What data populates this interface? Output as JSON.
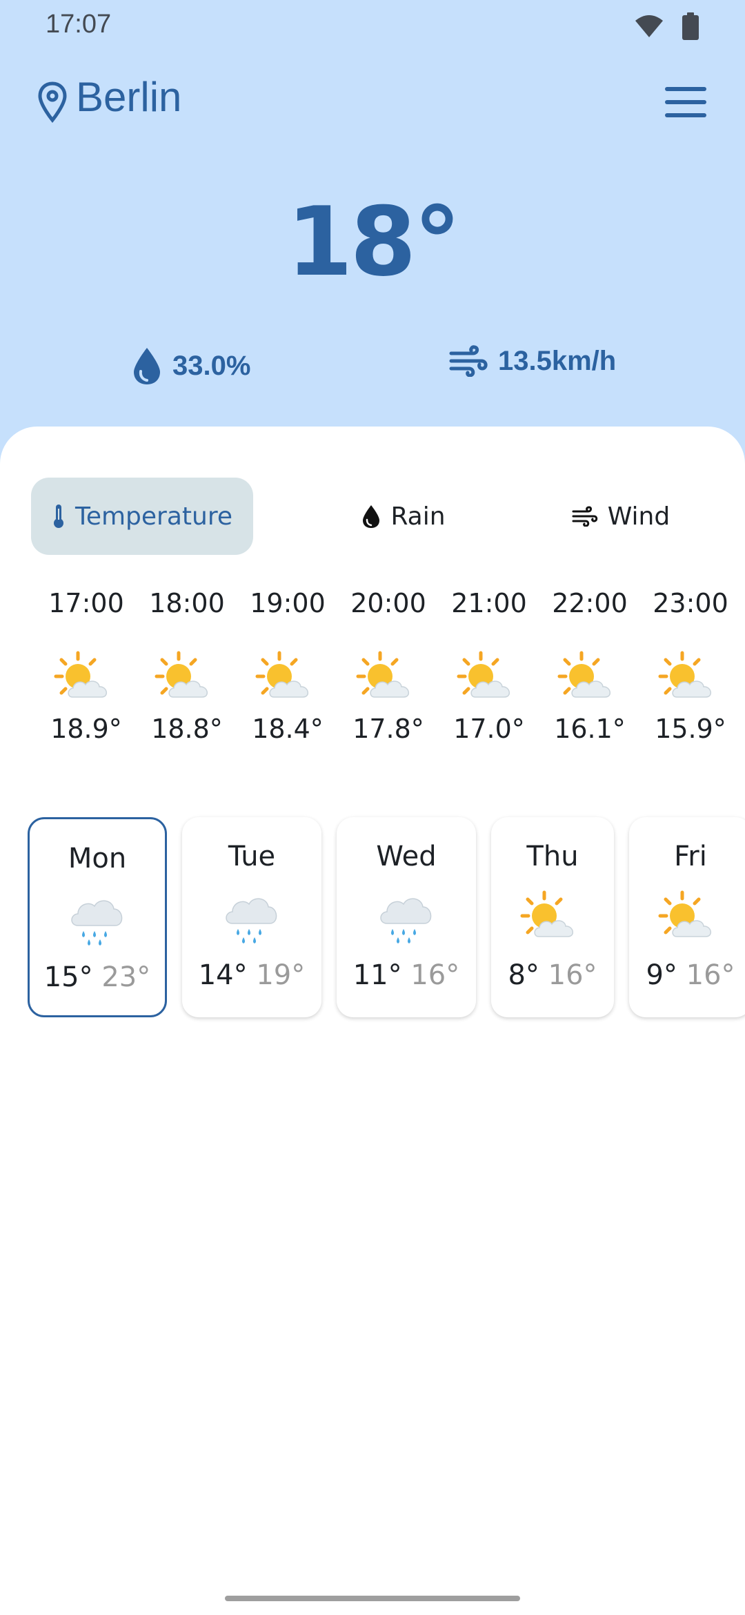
{
  "status_bar": {
    "time": "17:07",
    "icons": [
      "wifi-icon",
      "battery-icon"
    ]
  },
  "header": {
    "city": "Berlin",
    "location_icon": "location-pin-icon",
    "menu_icon": "menu-icon"
  },
  "current": {
    "temperature": "18°",
    "humidity": "33.0%",
    "wind": "13.5km/h"
  },
  "tabs": [
    {
      "label": "Temperature",
      "icon": "thermometer-icon",
      "active": true
    },
    {
      "label": "Rain",
      "icon": "raindrop-icon",
      "active": false
    },
    {
      "label": "Wind",
      "icon": "wind-icon",
      "active": false
    }
  ],
  "hourly": [
    {
      "time": "17:00",
      "icon": "sun-behind-cloud-icon",
      "temp": "18.9°"
    },
    {
      "time": "18:00",
      "icon": "sun-behind-cloud-icon",
      "temp": "18.8°"
    },
    {
      "time": "19:00",
      "icon": "sun-behind-cloud-icon",
      "temp": "18.4°"
    },
    {
      "time": "20:00",
      "icon": "sun-behind-cloud-icon",
      "temp": "17.8°"
    },
    {
      "time": "21:00",
      "icon": "sun-behind-cloud-icon",
      "temp": "17.0°"
    },
    {
      "time": "22:00",
      "icon": "sun-behind-cloud-icon",
      "temp": "16.1°"
    },
    {
      "time": "23:00",
      "icon": "sun-behind-cloud-icon",
      "temp": "15.9°"
    }
  ],
  "daily": [
    {
      "day": "Mon",
      "icon": "rain-cloud-icon",
      "low": "15°",
      "high": "23°",
      "selected": true
    },
    {
      "day": "Tue",
      "icon": "rain-cloud-icon",
      "low": "14°",
      "high": "19°",
      "selected": false
    },
    {
      "day": "Wed",
      "icon": "rain-cloud-icon",
      "low": "11°",
      "high": "16°",
      "selected": false
    },
    {
      "day": "Thu",
      "icon": "sun-behind-cloud-icon",
      "low": "8°",
      "high": "16°",
      "selected": false
    },
    {
      "day": "Fri",
      "icon": "sun-behind-cloud-icon",
      "low": "9°",
      "high": "16°",
      "selected": false
    }
  ],
  "colors": {
    "header_background": "#c6e0fc",
    "accent": "#2c62a0",
    "active_tab": "#d7e3e7",
    "text": "#1d2126",
    "muted_text": "#9a9a9a"
  }
}
